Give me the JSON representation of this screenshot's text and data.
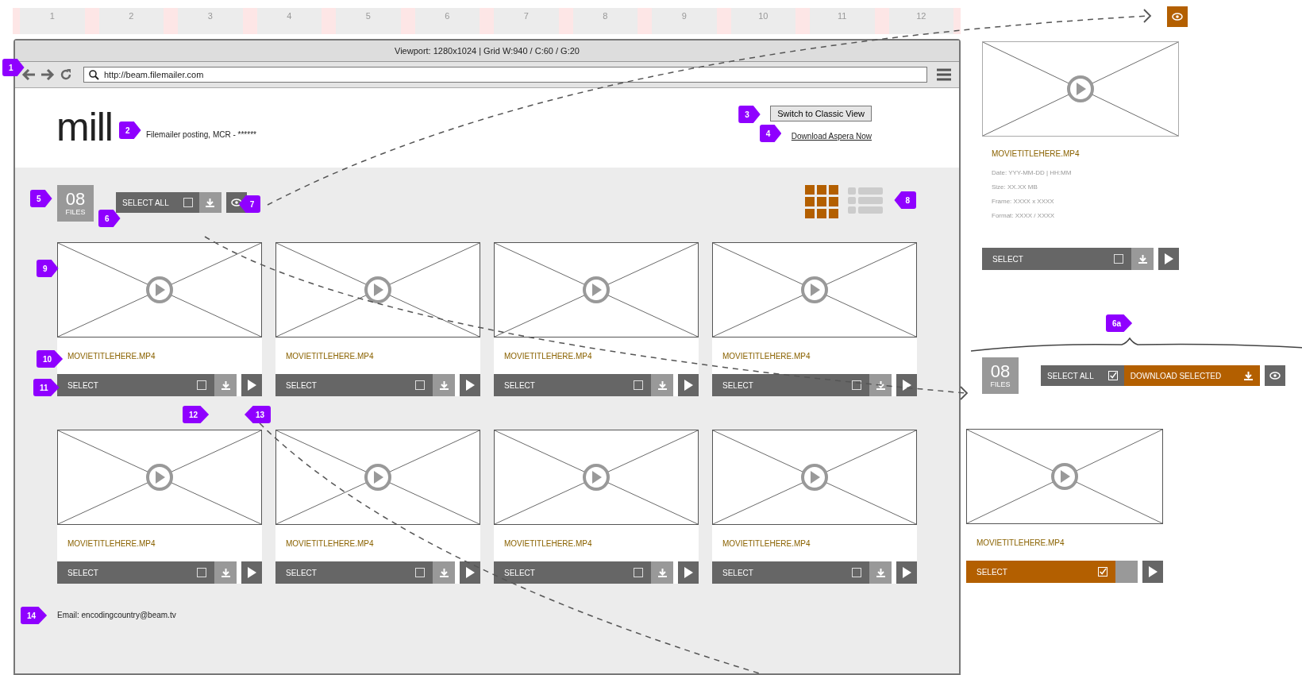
{
  "ruler": {
    "columns": [
      "1",
      "2",
      "3",
      "4",
      "5",
      "6",
      "7",
      "8",
      "9",
      "10",
      "11",
      "12"
    ]
  },
  "browser": {
    "viewport_label": "Viewport: 1280x1024 | Grid W:940 / C:60 / G:20",
    "nav_callout": "1",
    "url": "http://beam.filemailer.com"
  },
  "header": {
    "logo": "mill",
    "posting": "Filemailer posting, MCR - ******",
    "posting_callout": "2",
    "classic_button": "Switch to Classic View",
    "classic_callout": "3",
    "aspera_link": "Download Aspera Now",
    "aspera_callout": "4"
  },
  "toolbar": {
    "count": "08",
    "count_label": "FILES",
    "count_callout": "5",
    "select_all": "SELECT ALL",
    "select_all_checked": false,
    "select_all_callout": "6",
    "preview_active": false,
    "preview_callout": "7",
    "views_callout": "8",
    "views": [
      {
        "kind": "grid",
        "selected": true
      },
      {
        "kind": "list",
        "selected": false
      }
    ]
  },
  "cards": [
    {
      "title": "MOVIETITLEHERE.MP4",
      "select": "SELECT",
      "checked": false
    },
    {
      "title": "MOVIETITLEHERE.MP4",
      "select": "SELECT",
      "checked": false
    },
    {
      "title": "MOVIETITLEHERE.MP4",
      "select": "SELECT",
      "checked": false
    },
    {
      "title": "MOVIETITLEHERE.MP4",
      "select": "SELECT",
      "checked": false
    },
    {
      "title": "MOVIETITLEHERE.MP4",
      "select": "SELECT",
      "checked": false
    },
    {
      "title": "MOVIETITLEHERE.MP4",
      "select": "SELECT",
      "checked": false
    },
    {
      "title": "MOVIETITLEHERE.MP4",
      "select": "SELECT",
      "checked": false
    },
    {
      "title": "MOVIETITLEHERE.MP4",
      "select": "SELECT",
      "checked": false
    }
  ],
  "card_callouts": {
    "image": "9",
    "title": "10",
    "select": "11",
    "download": "12",
    "play": "13"
  },
  "footer": {
    "email": "Email: encodingcountry@beam.tv",
    "callout": "14"
  },
  "preview": {
    "eye_active": true,
    "title": "MOVIETITLEHERE.MP4",
    "meta": [
      "Date: YYY-MM-DD | HH:MM",
      "Size: XX.XX MB",
      "Frame: XXXX x XXXX",
      "Format: XXXX / XXXX"
    ],
    "select": "SELECT",
    "checked": false
  },
  "selected_state": {
    "callout": "6a",
    "count": "08",
    "count_label": "FILES",
    "select_all": "SELECT ALL",
    "select_all_checked": true,
    "download_selected": "DOWNLOAD SELECTED",
    "card": {
      "title": "MOVIETITLEHERE.MP4",
      "select": "SELECT",
      "checked": true
    }
  }
}
